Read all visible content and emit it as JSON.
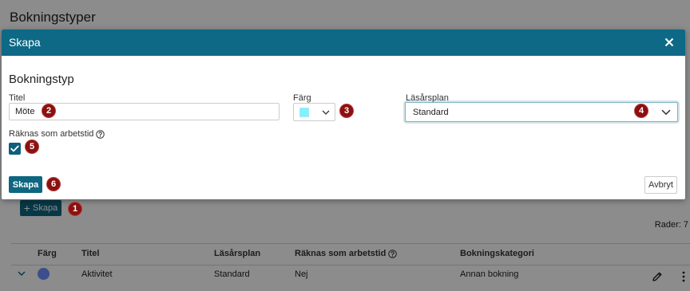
{
  "theme": {
    "primary": "#0e6986",
    "button": "#0e6680",
    "checkbox": "#0d5f7a",
    "badge": "#8b1010"
  },
  "page": {
    "title": "Bokningstyper",
    "create_button": {
      "icon": "+",
      "label": "Skapa"
    },
    "rows_count": "Rader: 7",
    "table": {
      "headers": {
        "color": "Färg",
        "title": "Titel",
        "plan": "Läsårsplan",
        "counts_as_work": "Räknas som arbetstid",
        "category": "Bokningskategori"
      },
      "rows": [
        {
          "color": "#6f8fff",
          "title": "Aktivitet",
          "plan": "Standard",
          "counts_as_work": "Nej",
          "category": "Annan bokning"
        }
      ]
    }
  },
  "modal": {
    "title": "Skapa",
    "section_heading": "Bokningstyp",
    "fields": {
      "title": {
        "label": "Titel",
        "value": "Möte"
      },
      "color": {
        "label": "Färg",
        "value": "#80f2ff"
      },
      "plan": {
        "label": "Läsårsplan",
        "selected": "Standard"
      },
      "counts_as_work": {
        "label": "Räknas som arbetstid",
        "checked": true
      }
    },
    "submit_label": "Skapa",
    "cancel_label": "Avbryt"
  },
  "icons": {
    "close": "close-icon",
    "dropdown": "chevron-down-icon",
    "help": "question-circle-icon",
    "check": "check-icon",
    "expand_row": "chevron-down-icon",
    "edit": "pencil-icon",
    "more": "kebab-icon"
  },
  "annotations": [
    "1",
    "2",
    "3",
    "4",
    "5",
    "6"
  ]
}
